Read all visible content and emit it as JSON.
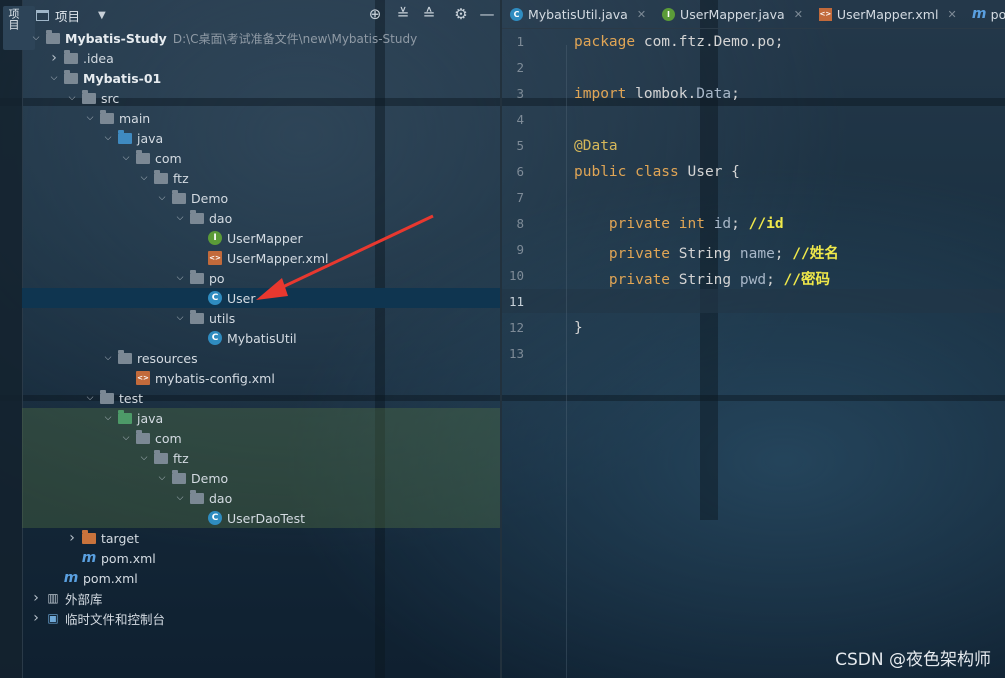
{
  "side_strip": {
    "label": "项目"
  },
  "project_header": {
    "title": "项目"
  },
  "tree": [
    {
      "depth": 0,
      "arrow": "down",
      "icon": "module",
      "label": "Mybatis-Study",
      "path": "D:\\C桌面\\考试准备文件\\new\\Mybatis-Study",
      "bold": true
    },
    {
      "depth": 1,
      "arrow": "right",
      "icon": "folder",
      "label": ".idea"
    },
    {
      "depth": 1,
      "arrow": "down",
      "icon": "module",
      "label": "Mybatis-01",
      "bold": true
    },
    {
      "depth": 2,
      "arrow": "down",
      "icon": "folder",
      "label": "src"
    },
    {
      "depth": 3,
      "arrow": "down",
      "icon": "folder",
      "label": "main"
    },
    {
      "depth": 4,
      "arrow": "down",
      "icon": "blue",
      "label": "java"
    },
    {
      "depth": 5,
      "arrow": "down",
      "icon": "folder",
      "label": "com"
    },
    {
      "depth": 6,
      "arrow": "down",
      "icon": "folder",
      "label": "ftz"
    },
    {
      "depth": 7,
      "arrow": "down",
      "icon": "folder",
      "label": "Demo"
    },
    {
      "depth": 8,
      "arrow": "down",
      "icon": "folder",
      "label": "dao"
    },
    {
      "depth": 9,
      "arrow": "none",
      "icon": "interface",
      "label": "UserMapper"
    },
    {
      "depth": 9,
      "arrow": "none",
      "icon": "xml",
      "label": "UserMapper.xml"
    },
    {
      "depth": 8,
      "arrow": "down",
      "icon": "folder",
      "label": "po"
    },
    {
      "depth": 9,
      "arrow": "none",
      "icon": "class",
      "label": "User",
      "selected": true
    },
    {
      "depth": 8,
      "arrow": "down",
      "icon": "folder",
      "label": "utils"
    },
    {
      "depth": 9,
      "arrow": "none",
      "icon": "class",
      "label": "MybatisUtil"
    },
    {
      "depth": 4,
      "arrow": "down",
      "icon": "resources",
      "label": "resources"
    },
    {
      "depth": 5,
      "arrow": "none",
      "icon": "xml",
      "label": "mybatis-config.xml"
    },
    {
      "depth": 3,
      "arrow": "down",
      "icon": "folder",
      "label": "test"
    },
    {
      "depth": 4,
      "arrow": "down",
      "icon": "green",
      "label": "java",
      "hl": true
    },
    {
      "depth": 5,
      "arrow": "down",
      "icon": "folder",
      "label": "com",
      "hl": true
    },
    {
      "depth": 6,
      "arrow": "down",
      "icon": "folder",
      "label": "ftz",
      "hl": true
    },
    {
      "depth": 7,
      "arrow": "down",
      "icon": "folder",
      "label": "Demo",
      "hl": true
    },
    {
      "depth": 8,
      "arrow": "down",
      "icon": "folder",
      "label": "dao",
      "hl": true
    },
    {
      "depth": 9,
      "arrow": "none",
      "icon": "testclass",
      "label": "UserDaoTest",
      "hl": true
    },
    {
      "depth": 2,
      "arrow": "right",
      "icon": "orange",
      "label": "target"
    },
    {
      "depth": 2,
      "arrow": "none",
      "icon": "maven",
      "label": "pom.xml"
    },
    {
      "depth": 1,
      "arrow": "none",
      "icon": "maven",
      "label": "pom.xml"
    },
    {
      "depth": 0,
      "arrow": "right",
      "icon": "library",
      "label": "外部库"
    },
    {
      "depth": 0,
      "arrow": "right",
      "icon": "scratch",
      "label": "临时文件和控制台"
    }
  ],
  "tabs": [
    {
      "label": "MybatisUtil.java",
      "icon": "class"
    },
    {
      "label": "UserMapper.java",
      "icon": "interface"
    },
    {
      "label": "UserMapper.xml",
      "icon": "xml"
    },
    {
      "label": "pom.xml",
      "icon": "maven"
    }
  ],
  "editor": {
    "current_line": 11,
    "lines": [
      {
        "n": "1",
        "tokens": [
          [
            "kw",
            "package "
          ],
          [
            "txt",
            "com.ftz.Demo.po;"
          ]
        ]
      },
      {
        "n": "2",
        "tokens": []
      },
      {
        "n": "3",
        "tokens": [
          [
            "kw",
            "import "
          ],
          [
            "txt",
            "lombok."
          ],
          [
            "id",
            "Data"
          ],
          [
            "txt",
            ";"
          ]
        ]
      },
      {
        "n": "4",
        "tokens": []
      },
      {
        "n": "5",
        "tokens": [
          [
            "ann",
            "@Data"
          ]
        ]
      },
      {
        "n": "6",
        "tokens": [
          [
            "kw",
            "public class "
          ],
          [
            "txt",
            "User {"
          ]
        ]
      },
      {
        "n": "7",
        "tokens": []
      },
      {
        "n": "8",
        "tokens": [
          [
            "txt",
            "    "
          ],
          [
            "kw",
            "private int "
          ],
          [
            "id",
            "id"
          ],
          [
            "txt",
            "; "
          ],
          [
            "cm",
            "//id"
          ]
        ]
      },
      {
        "n": "9",
        "tokens": [
          [
            "txt",
            "    "
          ],
          [
            "kw",
            "private "
          ],
          [
            "txt",
            "String "
          ],
          [
            "id",
            "name"
          ],
          [
            "txt",
            "; "
          ],
          [
            "cm",
            "//姓名"
          ]
        ]
      },
      {
        "n": "10",
        "tokens": [
          [
            "txt",
            "    "
          ],
          [
            "kw",
            "private "
          ],
          [
            "txt",
            "String "
          ],
          [
            "id",
            "pwd"
          ],
          [
            "txt",
            "; "
          ],
          [
            "cm",
            "//密码"
          ]
        ]
      },
      {
        "n": "11",
        "tokens": []
      },
      {
        "n": "12",
        "tokens": [
          [
            "txt",
            "}"
          ]
        ]
      },
      {
        "n": "13",
        "tokens": []
      }
    ]
  },
  "watermark": "CSDN @夜色架构师"
}
